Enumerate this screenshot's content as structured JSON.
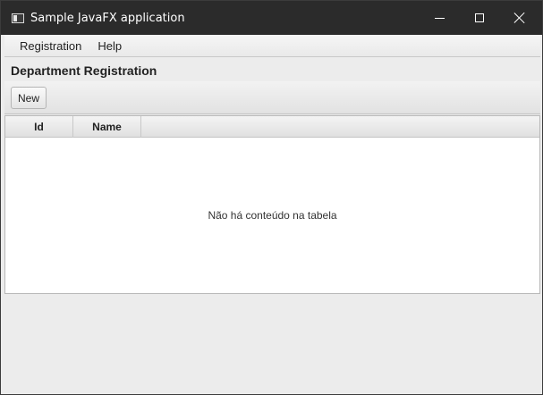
{
  "window": {
    "title": "Sample JavaFX application"
  },
  "menu": {
    "items": [
      {
        "label": "Registration"
      },
      {
        "label": "Help"
      }
    ]
  },
  "page": {
    "heading": "Department Registration"
  },
  "toolbar": {
    "new_label": "New"
  },
  "table": {
    "columns": [
      {
        "label": "Id"
      },
      {
        "label": "Name"
      }
    ],
    "empty_message": "Não há conteúdo na tabela",
    "rows": []
  },
  "icons": {
    "app": "app-window-icon",
    "minimize": "minimize-icon",
    "maximize": "maximize-icon",
    "close": "close-icon"
  }
}
